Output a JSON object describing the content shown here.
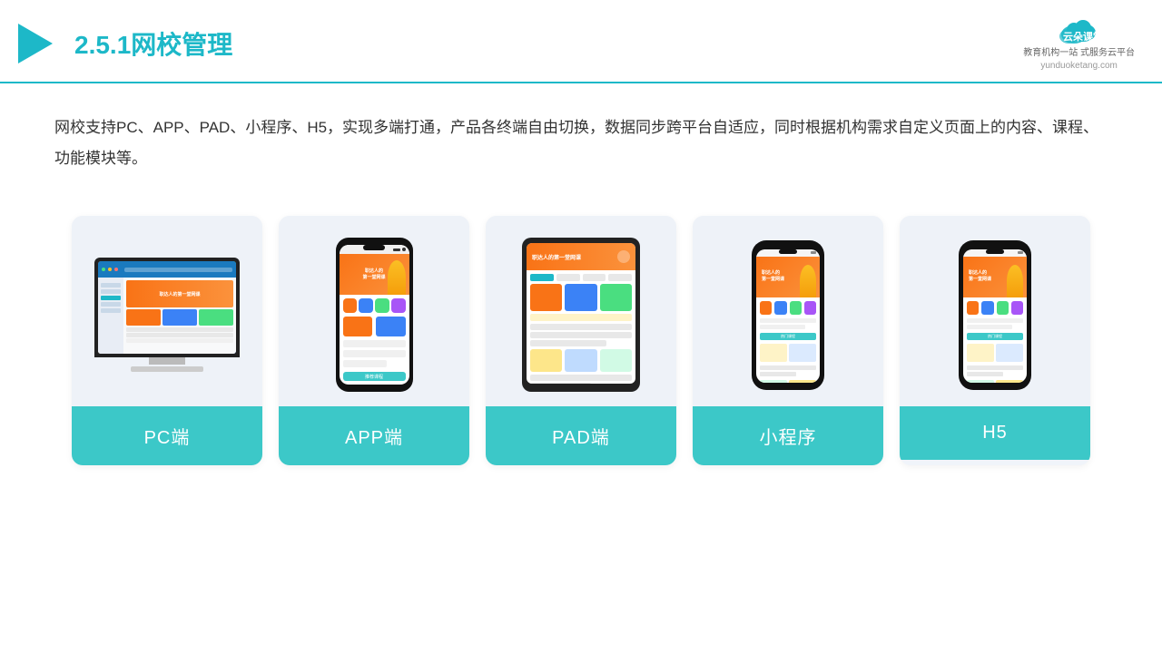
{
  "header": {
    "section_number": "2.5.1",
    "title_plain": "网校管理",
    "play_color": "#1db8c8",
    "border_color": "#1db8c8"
  },
  "logo": {
    "main_text": "云朵课堂",
    "sub_text": "教育机构一站\n式服务云平台",
    "domain": "yunduoketang.com"
  },
  "description": {
    "text": "网校支持PC、APP、PAD、小程序、H5，实现多端打通，产品各终端自由切换，数据同步跨平台自适应，同时根据机构需求自定义页面上的内容、课程、功能模块等。"
  },
  "cards": [
    {
      "id": "pc",
      "label": "PC端"
    },
    {
      "id": "app",
      "label": "APP端"
    },
    {
      "id": "pad",
      "label": "PAD端"
    },
    {
      "id": "miniprogram",
      "label": "小程序"
    },
    {
      "id": "h5",
      "label": "H5"
    }
  ],
  "colors": {
    "accent": "#1db8c8",
    "card_bg": "#eef2f8",
    "card_label_bg": "#3cc8c8",
    "card_label_text": "#ffffff"
  }
}
